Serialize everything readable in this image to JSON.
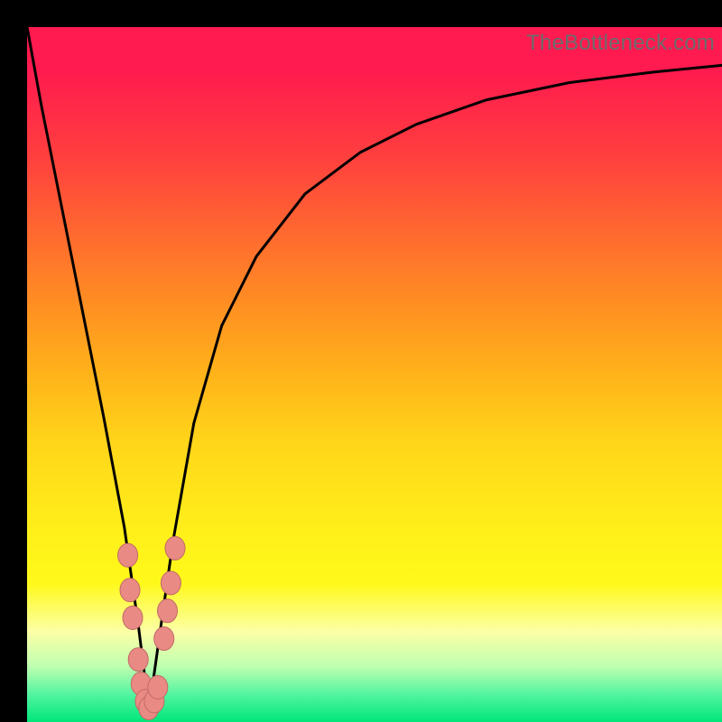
{
  "watermark": "TheBottleneck.com",
  "colors": {
    "frame": "#000000",
    "curve_stroke": "#000000",
    "marker_fill": "#e98a85",
    "marker_stroke": "#c26a66",
    "gradient_top": "#ff1a4f",
    "gradient_bottom": "#00e67a"
  },
  "chart_data": {
    "type": "line",
    "title": "",
    "xlabel": "",
    "ylabel": "",
    "xlim": [
      0,
      100
    ],
    "ylim": [
      0,
      100
    ],
    "series": [
      {
        "name": "bottleneck-curve",
        "x": [
          0,
          2,
          5,
          8,
          11,
          14,
          16,
          17.5,
          17.6,
          19,
          21,
          24,
          28,
          33,
          40,
          48,
          56,
          66,
          78,
          90,
          100
        ],
        "values": [
          100,
          89,
          74,
          59,
          44,
          28,
          14,
          2,
          2,
          12,
          26,
          43,
          57,
          67,
          76,
          82,
          86,
          89.5,
          92,
          93.5,
          94.5
        ]
      }
    ],
    "markers": [
      {
        "x": 14.5,
        "y": 24
      },
      {
        "x": 14.8,
        "y": 19
      },
      {
        "x": 15.2,
        "y": 15
      },
      {
        "x": 16.0,
        "y": 9
      },
      {
        "x": 16.4,
        "y": 5.5
      },
      {
        "x": 17.0,
        "y": 3
      },
      {
        "x": 17.5,
        "y": 2
      },
      {
        "x": 18.3,
        "y": 3
      },
      {
        "x": 18.8,
        "y": 5
      },
      {
        "x": 19.7,
        "y": 12
      },
      {
        "x": 20.2,
        "y": 16
      },
      {
        "x": 20.7,
        "y": 20
      },
      {
        "x": 21.3,
        "y": 25
      }
    ]
  }
}
